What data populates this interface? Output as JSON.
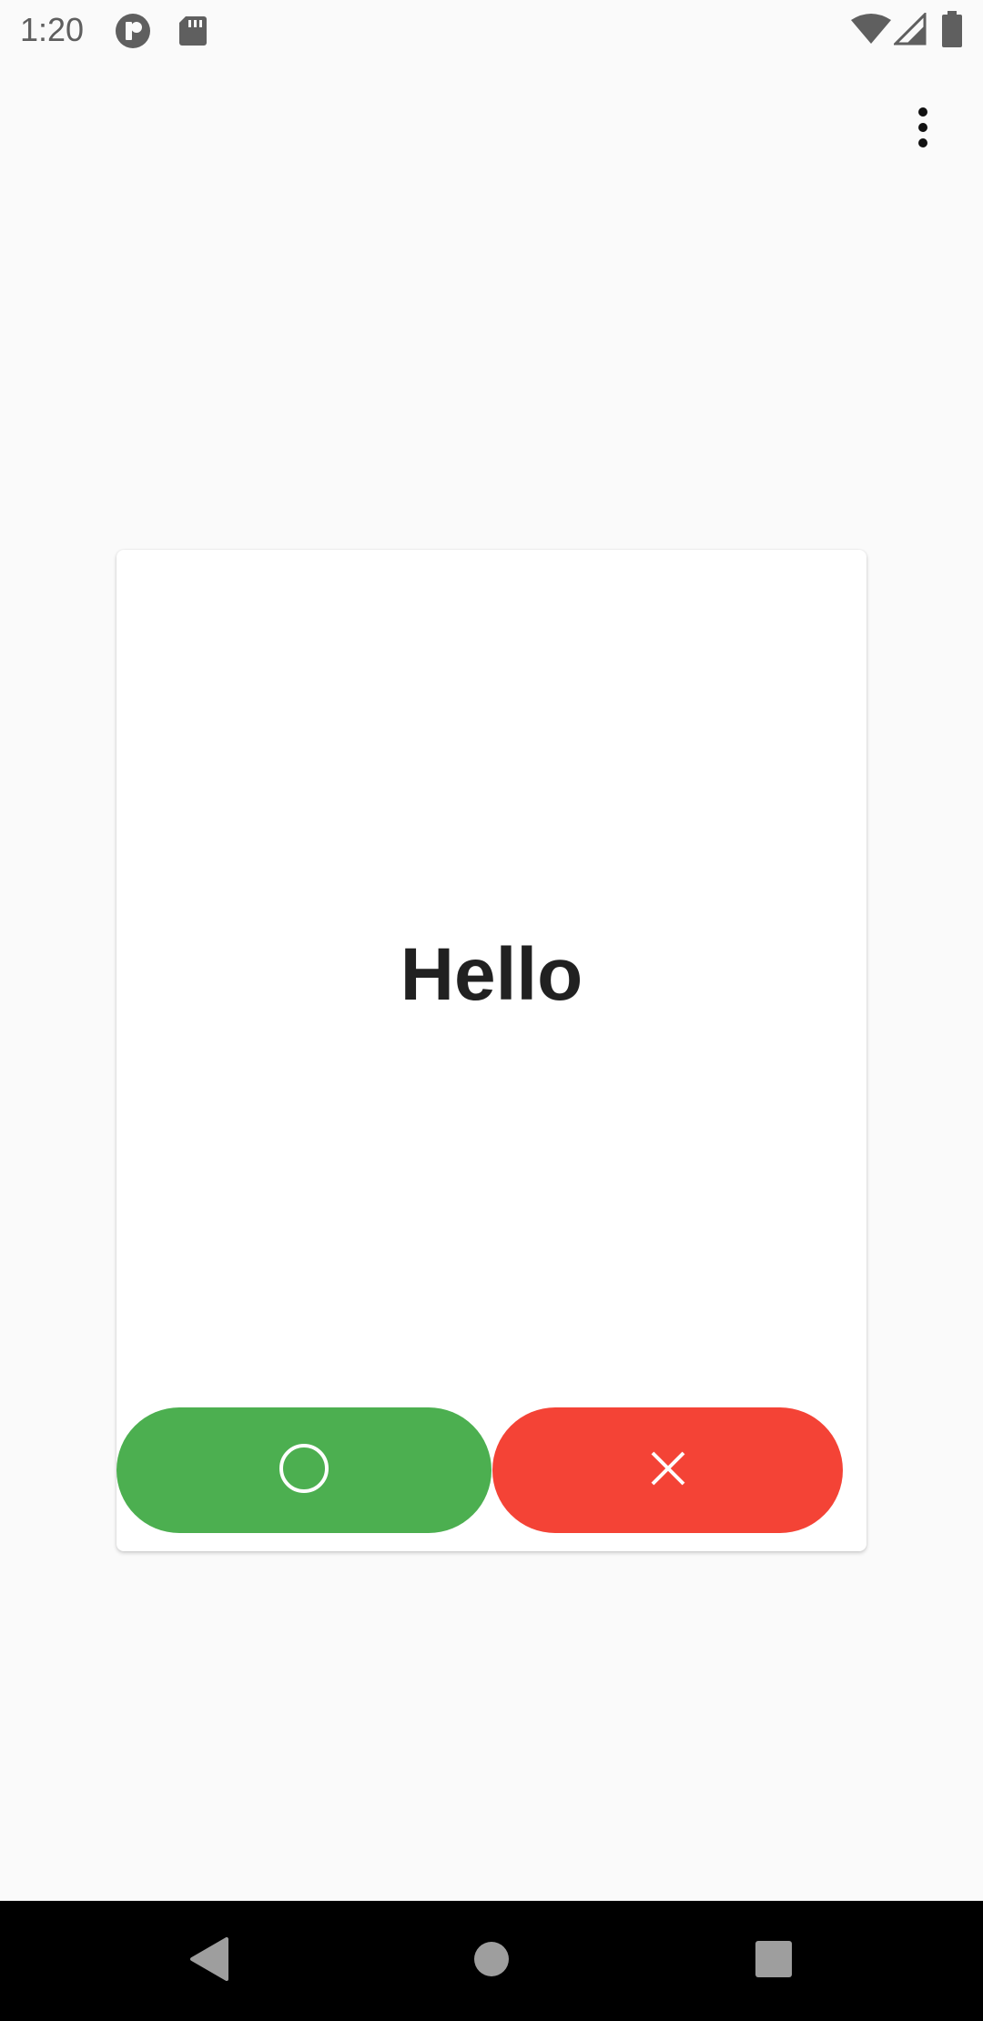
{
  "status_bar": {
    "time": "1:20",
    "icons_left": [
      "app-notification-icon",
      "sd-card-icon"
    ],
    "icons_right": [
      "wifi-icon",
      "cellular-signal-icon",
      "battery-icon"
    ]
  },
  "app_bar": {
    "menu_icon": "more-vert-icon"
  },
  "card": {
    "word": "Hello",
    "correct_button_icon": "circle-icon",
    "wrong_button_icon": "cross-icon"
  },
  "colors": {
    "correct": "#4caf50",
    "wrong": "#f44336",
    "background": "#fafafa",
    "card": "#ffffff",
    "text": "#212121"
  },
  "nav_bar": {
    "back_icon": "back-triangle-icon",
    "home_icon": "home-circle-icon",
    "recents_icon": "recents-square-icon"
  }
}
